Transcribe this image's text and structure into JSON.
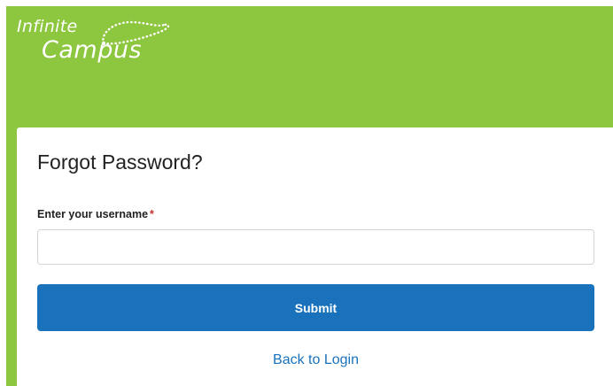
{
  "brand": {
    "logo_line1": "Infinite",
    "logo_line2": "Campus",
    "logo_icon": "dotted-orbit-icon",
    "colors": {
      "brand_green": "#8dc63f",
      "primary_blue": "#1a72bc",
      "required_red": "#c9302c"
    }
  },
  "form": {
    "title": "Forgot Password?",
    "username_label": "Enter your username",
    "required_marker": "*",
    "username_value": "",
    "username_placeholder": "",
    "submit_label": "Submit",
    "back_label": "Back to Login"
  }
}
